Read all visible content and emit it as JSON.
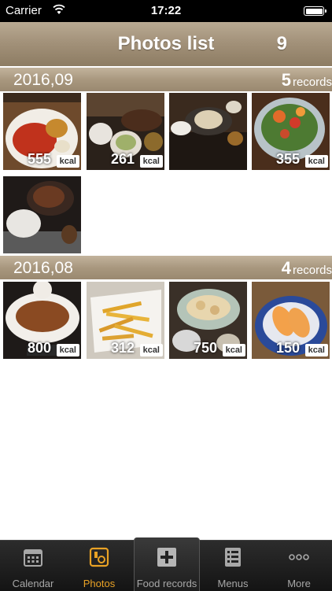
{
  "status": {
    "carrier": "Carrier",
    "time": "17:22"
  },
  "nav": {
    "title": "Photos list",
    "count": "9"
  },
  "sections": [
    {
      "date": "2016,09",
      "count": "5",
      "count_label": "records",
      "photos": [
        {
          "kcal": "555",
          "unit": "kcal"
        },
        {
          "kcal": "261",
          "unit": "kcal"
        },
        {
          "kcal": "",
          "unit": ""
        },
        {
          "kcal": "355",
          "unit": "kcal"
        },
        {
          "kcal": "",
          "unit": ""
        }
      ]
    },
    {
      "date": "2016,08",
      "count": "4",
      "count_label": "records",
      "photos": [
        {
          "kcal": "800",
          "unit": "kcal"
        },
        {
          "kcal": "312",
          "unit": "kcal"
        },
        {
          "kcal": "750",
          "unit": "kcal"
        },
        {
          "kcal": "150",
          "unit": "kcal"
        }
      ]
    }
  ],
  "tabs": [
    {
      "label": "Calendar",
      "icon": "calendar-icon"
    },
    {
      "label": "Photos",
      "icon": "photos-icon"
    },
    {
      "label": "Food records",
      "icon": "add-record-icon"
    },
    {
      "label": "Menus",
      "icon": "menu-list-icon"
    },
    {
      "label": "More",
      "icon": "more-icon"
    }
  ],
  "colors": {
    "accent": "#e9a225",
    "header": "#a3927a",
    "tabbar": "#1b1b1b"
  }
}
